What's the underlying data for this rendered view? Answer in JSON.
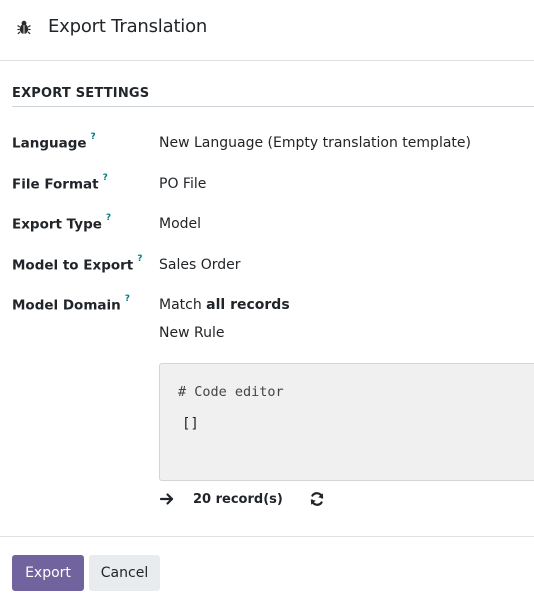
{
  "dialog": {
    "title": "Export Translation",
    "icon": "bug-icon"
  },
  "section": {
    "title": "EXPORT SETTINGS"
  },
  "fields": [
    {
      "label": "Language",
      "help": "?",
      "value": "New Language (Empty translation template)"
    },
    {
      "label": "File Format",
      "help": "?",
      "value": "PO File"
    },
    {
      "label": "Export Type",
      "help": "?",
      "value": "Model"
    },
    {
      "label": "Model to Export",
      "help": "?",
      "value": "Sales Order"
    },
    {
      "label": "Model Domain",
      "help": "?",
      "value_prefix": "Match ",
      "value_bold": "all records"
    }
  ],
  "domain": {
    "new_rule": "New Rule",
    "code_comment": "# Code editor",
    "code_value": "[]",
    "record_count": "20 record(s)"
  },
  "footer": {
    "export_label": "Export",
    "cancel_label": "Cancel"
  },
  "colors": {
    "primary": "#71639e",
    "help": "#017e84"
  }
}
